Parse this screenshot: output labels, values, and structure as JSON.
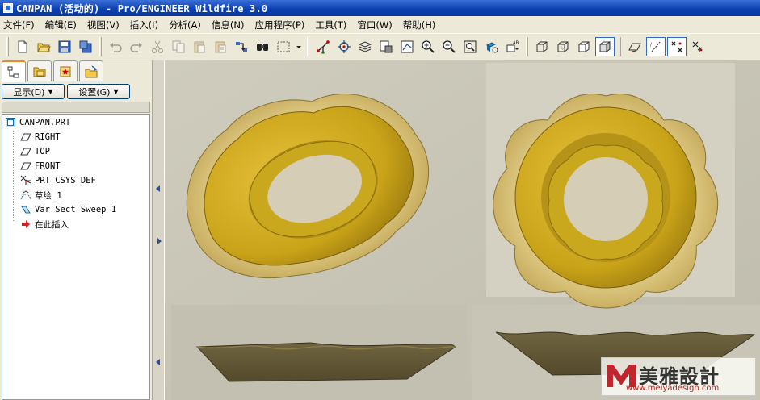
{
  "window": {
    "title": "CANPAN (活动的) - Pro/ENGINEER Wildfire 3.0"
  },
  "menu": [
    {
      "label": "文件(F)"
    },
    {
      "label": "编辑(E)"
    },
    {
      "label": "视图(V)"
    },
    {
      "label": "插入(I)"
    },
    {
      "label": "分析(A)"
    },
    {
      "label": "信息(N)"
    },
    {
      "label": "应用程序(P)"
    },
    {
      "label": "工具(T)"
    },
    {
      "label": "窗口(W)"
    },
    {
      "label": "帮助(H)"
    }
  ],
  "toolbar": {
    "icons": [
      "new-file-icon",
      "open-folder-icon",
      "save-icon",
      "save-copy-icon",
      "undo-icon",
      "redo-icon",
      "cut-icon",
      "copy-icon",
      "paste-icon",
      "paste-special-icon",
      "regenerate-icon",
      "find-icon",
      "select-box-icon",
      "datum-axis-icon",
      "spin-center-icon",
      "layers-icon",
      "view-manager-icon",
      "sketch-view-icon",
      "zoom-in-icon",
      "zoom-out-icon",
      "refit-icon",
      "orient-icon",
      "saved-views-icon",
      "wireframe-icon",
      "hidden-line-icon",
      "no-hidden-icon",
      "shading-icon",
      "datum-plane-display-icon",
      "datum-axis-display-icon",
      "datum-point-display-icon",
      "csys-display-icon"
    ]
  },
  "panel": {
    "tabs": [
      {
        "icon": "model-tree-icon"
      },
      {
        "icon": "folder-browser-icon"
      },
      {
        "icon": "favorites-icon"
      },
      {
        "icon": "connections-icon"
      }
    ],
    "show_label": "显示(D)",
    "settings_label": "设置(G)",
    "tree": [
      {
        "label": "CANPAN.PRT",
        "icon": "part-icon"
      },
      {
        "label": "RIGHT",
        "icon": "datum-plane-icon"
      },
      {
        "label": "TOP",
        "icon": "datum-plane-icon"
      },
      {
        "label": "FRONT",
        "icon": "datum-plane-icon"
      },
      {
        "label": "PRT_CSYS_DEF",
        "icon": "csys-icon"
      },
      {
        "label": "草绘 1",
        "icon": "sketch-icon"
      },
      {
        "label": "Var Sect Sweep 1",
        "icon": "sweep-icon"
      },
      {
        "label": "在此插入",
        "icon": "insert-here-icon"
      }
    ]
  },
  "watermark": {
    "brand": "美雅設計",
    "url": "www.meiyadesign.com",
    "brand_color": "#c0262d"
  },
  "colors": {
    "title_bar": "#0a3fb0",
    "model_gold": "#c9a318",
    "model_outer": "#d8c27a",
    "viewport_bg": "#c9c6b8"
  }
}
